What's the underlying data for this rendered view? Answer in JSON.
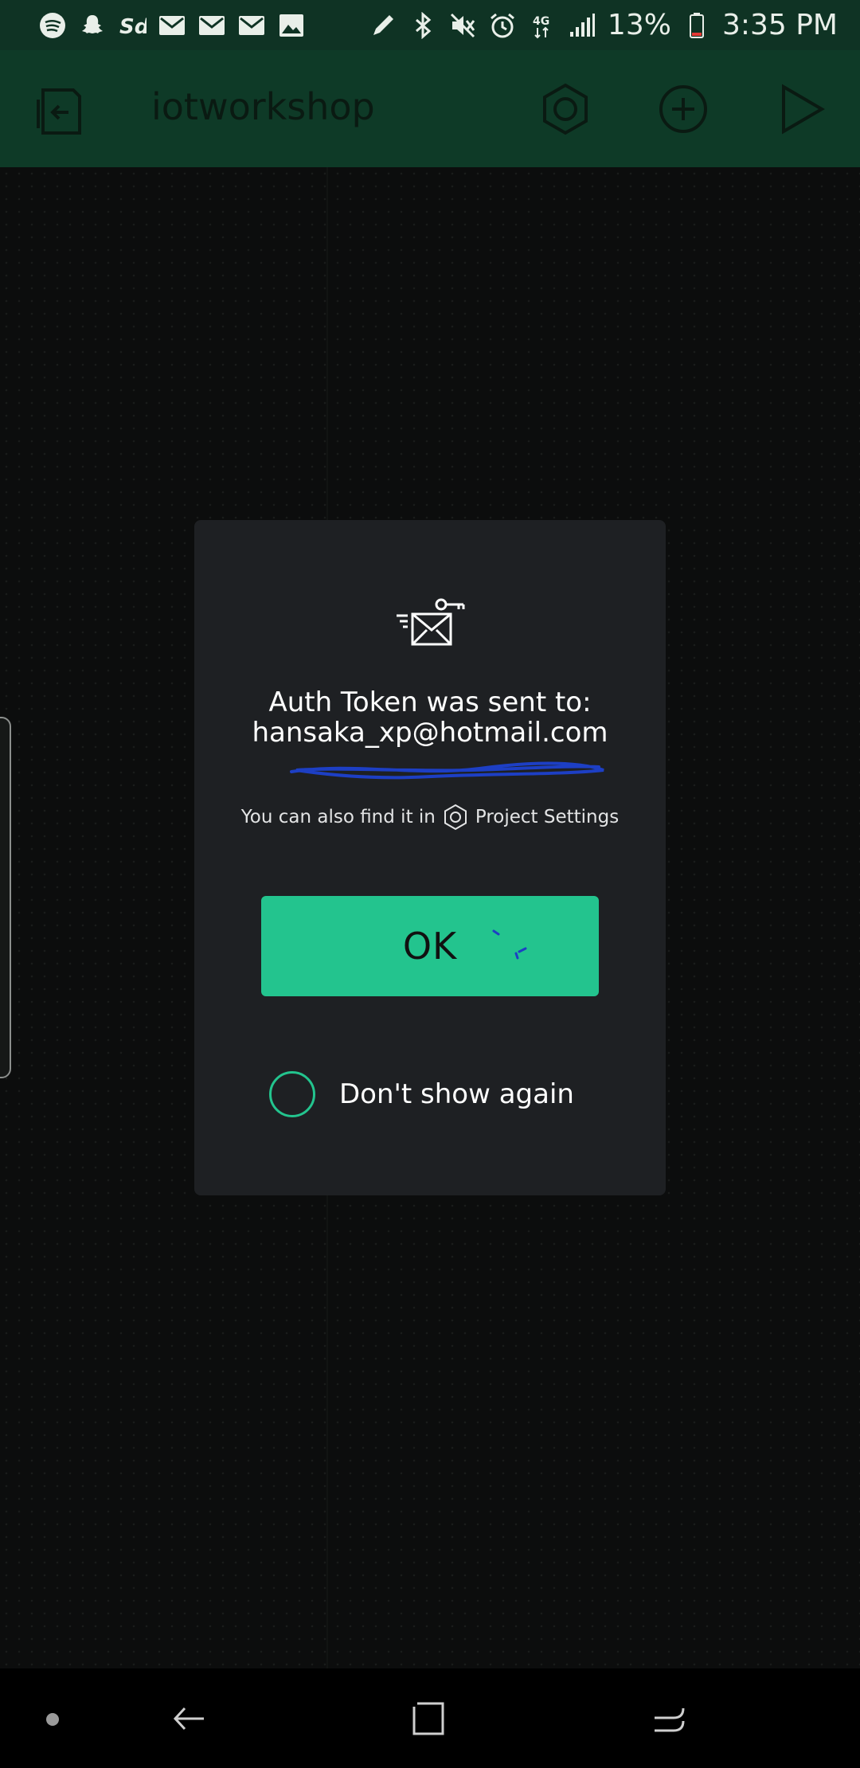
{
  "status_bar": {
    "battery_percent": "13%",
    "time": "3:35 PM",
    "left_icons": [
      "spotify-icon",
      "snapchat-icon",
      "sd-icon",
      "gmail-icon",
      "gmail-icon",
      "gmail-icon",
      "gallery-icon"
    ],
    "right_icons": [
      "pen-icon",
      "bluetooth-icon",
      "mute-icon",
      "alarm-icon",
      "4g-icon",
      "signal-icon",
      "battery-icon"
    ]
  },
  "toolbar": {
    "title": "iotworkshop",
    "color": "#0e3a27"
  },
  "dialog": {
    "title": "Auth Token was sent to:",
    "email": "hansaka_xp@hotmail.com",
    "hint_prefix": "You can also find it in",
    "hint_link": "Project Settings",
    "ok_label": "OK",
    "dont_show_label": "Don't show again",
    "accent_color": "#23c48e"
  }
}
